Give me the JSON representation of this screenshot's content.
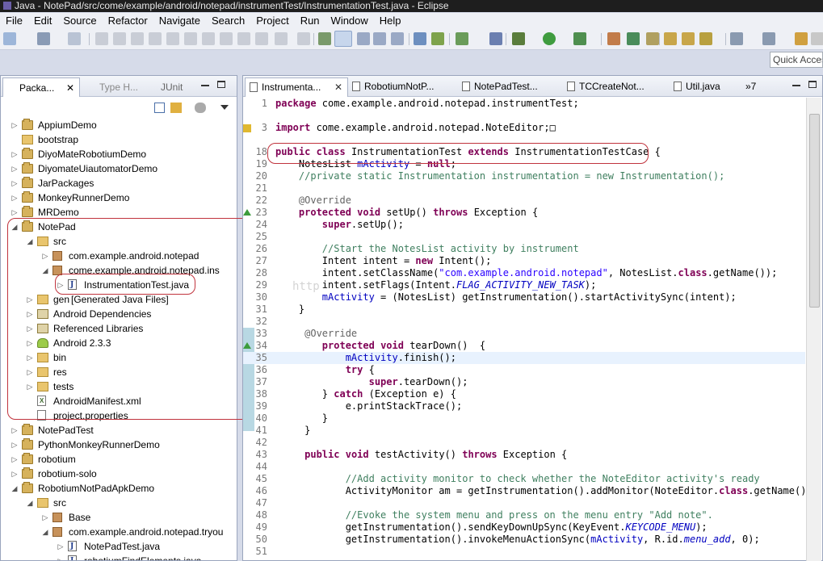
{
  "window": {
    "title": "Java - NotePad/src/come/example/android/notepad/instrumentTest/InstrumentationTest.java - Eclipse"
  },
  "menu": [
    {
      "label": "File"
    },
    {
      "label": "Edit"
    },
    {
      "label": "Source"
    },
    {
      "label": "Refactor"
    },
    {
      "label": "Navigate"
    },
    {
      "label": "Search"
    },
    {
      "label": "Project"
    },
    {
      "label": "Run"
    },
    {
      "label": "Window"
    },
    {
      "label": "Help"
    }
  ],
  "quick_access": {
    "placeholder": "Quick Access"
  },
  "package_explorer": {
    "tabs": [
      {
        "label": "Packa..."
      },
      {
        "label": "Type H..."
      },
      {
        "label": "JUnit"
      }
    ],
    "rows": [
      {
        "label": "AppiumDemo"
      },
      {
        "label": "bootstrap"
      },
      {
        "label": "DiyoMateRobotiumDemo"
      },
      {
        "label": "DiyomateUiautomatorDemo"
      },
      {
        "label": "JarPackages"
      },
      {
        "label": "MonkeyRunnerDemo"
      },
      {
        "label": "MRDemo"
      },
      {
        "label": "NotePad"
      },
      {
        "label": "src"
      },
      {
        "label": "com.example.android.notepad"
      },
      {
        "label": "come.example.android.notepad.ins"
      },
      {
        "label": "InstrumentationTest.java"
      },
      {
        "label": "gen",
        "decor": "[Generated Java Files]"
      },
      {
        "label": "Android Dependencies"
      },
      {
        "label": "Referenced Libraries"
      },
      {
        "label": "Android 2.3.3"
      },
      {
        "label": "bin"
      },
      {
        "label": "res"
      },
      {
        "label": "tests"
      },
      {
        "label": "AndroidManifest.xml"
      },
      {
        "label": "project.properties"
      },
      {
        "label": "NotePadTest"
      },
      {
        "label": "PythonMonkeyRunnerDemo"
      },
      {
        "label": "robotium"
      },
      {
        "label": "robotium-solo"
      },
      {
        "label": "RobotiumNotPadApkDemo"
      },
      {
        "label": "src"
      },
      {
        "label": "Base"
      },
      {
        "label": "com.example.android.notepad.tryou"
      },
      {
        "label": "NotePadTest.java"
      },
      {
        "label": "robotiumFindElements.java"
      }
    ]
  },
  "editor": {
    "tabs": [
      {
        "label": "Instrumenta..."
      },
      {
        "label": "RobotiumNotP..."
      },
      {
        "label": "NotePadTest..."
      },
      {
        "label": "TCCreateNot..."
      },
      {
        "label": "Util.java"
      },
      {
        "label": "»7"
      }
    ],
    "watermark": "http"
  },
  "code_lines": [
    {
      "n": "1"
    },
    {
      "n": "3"
    },
    {
      "n": "18"
    },
    {
      "n": "19"
    },
    {
      "n": "20"
    },
    {
      "n": "21"
    },
    {
      "n": "22"
    },
    {
      "n": "23"
    },
    {
      "n": "24"
    },
    {
      "n": "25"
    },
    {
      "n": "26"
    },
    {
      "n": "27"
    },
    {
      "n": "28"
    },
    {
      "n": "29"
    },
    {
      "n": "30"
    },
    {
      "n": "31"
    },
    {
      "n": "32"
    },
    {
      "n": "33"
    },
    {
      "n": "34"
    },
    {
      "n": "35"
    },
    {
      "n": "36"
    },
    {
      "n": "37"
    },
    {
      "n": "38"
    },
    {
      "n": "39"
    },
    {
      "n": "40"
    },
    {
      "n": "41"
    },
    {
      "n": "42"
    },
    {
      "n": "43"
    },
    {
      "n": "44"
    },
    {
      "n": "45"
    },
    {
      "n": "46"
    },
    {
      "n": "47"
    },
    {
      "n": "48"
    },
    {
      "n": "49"
    },
    {
      "n": "50"
    },
    {
      "n": "51"
    }
  ],
  "code": {
    "l1": [
      "package",
      " come.example.android.notepad.instrumentTest;"
    ],
    "l3": [
      "import",
      " come.example.android.notepad.NoteEditor;"
    ],
    "l18": [
      "public",
      "class",
      " InstrumentationTest ",
      "extends",
      " InstrumentationTestCase {"
    ],
    "l19": [
      "    NotesList ",
      "mActivity",
      " = ",
      "null",
      ";"
    ],
    "l20": "    //private static Instrumentation instrumentation = new Instrumentation();",
    "l22": "    @Override",
    "l23": [
      "protected",
      "void",
      " setUp() ",
      "throws",
      " Exception {"
    ],
    "l24": [
      "super",
      ".setUp();"
    ],
    "l26": "        //Start the NotesList activity by instrument",
    "l27": [
      "        Intent intent = ",
      "new",
      " Intent();"
    ],
    "l28": [
      "        intent.setClassName(",
      "\"com.example.android.notepad\"",
      ", NotesList.",
      "class",
      ".getName());"
    ],
    "l29": [
      "        intent.setFlags(Intent.",
      "FLAG_ACTIVITY_NEW_TASK",
      ");"
    ],
    "l30": [
      "mActivity",
      " = (NotesList) getInstrumentation().startActivitySync(intent);"
    ],
    "l31": "    }",
    "l33": "     @Override",
    "l34": [
      "protected",
      "void",
      " tearDown()  {"
    ],
    "l35": [
      "mActivity",
      ".finish();"
    ],
    "l36": [
      "try",
      " {"
    ],
    "l37": [
      "super",
      ".tearDown();"
    ],
    "l38": [
      "        } ",
      "catch",
      " (Exception e) {"
    ],
    "l39": "            e.printStackTrace();",
    "l40": "        }",
    "l41": "     }",
    "l43": [
      "public",
      "void",
      " testActivity() ",
      "throws",
      " Exception {"
    ],
    "l45": "            //Add activity monitor to check whether the NoteEditor activity's ready",
    "l46": [
      "            ActivityMonitor am = getInstrumentation().addMonitor(NoteEditor.",
      "class",
      ".getName(), n"
    ],
    "l48": "            //Evoke the system menu and press on the menu entry \"Add note\".",
    "l49": [
      "            getInstrumentation().sendKeyDownUpSync(KeyEvent.",
      "KEYCODE_MENU",
      ");"
    ],
    "l50": [
      "            getInstrumentation().invokeMenuActionSync(",
      "mActivity",
      ", R.id.",
      "menu_add",
      ", 0);"
    ]
  }
}
